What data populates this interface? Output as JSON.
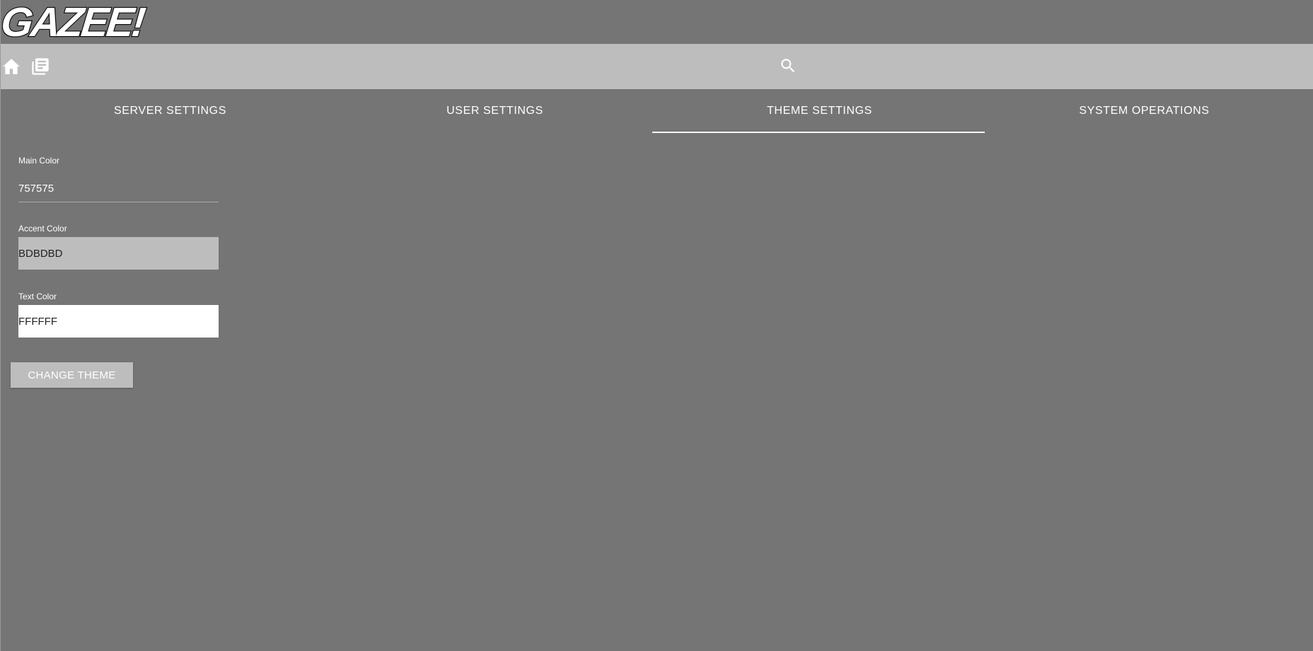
{
  "app": {
    "logo_text": "GAZEE!"
  },
  "toolbar": {
    "home_icon": "home-icon",
    "library_icon": "library-books-icon",
    "search_icon": "search-icon"
  },
  "tabs": [
    {
      "label": "SERVER SETTINGS",
      "active": false
    },
    {
      "label": "USER SETTINGS",
      "active": false
    },
    {
      "label": "THEME SETTINGS",
      "active": true
    },
    {
      "label": "SYSTEM OPERATIONS",
      "active": false
    }
  ],
  "theme_form": {
    "main_color": {
      "label": "Main Color",
      "value": "757575"
    },
    "accent_color": {
      "label": "Accent Color",
      "value": "BDBDBD"
    },
    "text_color": {
      "label": "Text Color",
      "value": "FFFFFF"
    },
    "submit_label": "CHANGE THEME"
  },
  "colors": {
    "main": "#757575",
    "accent": "#BDBDBD",
    "text": "#FFFFFF"
  }
}
